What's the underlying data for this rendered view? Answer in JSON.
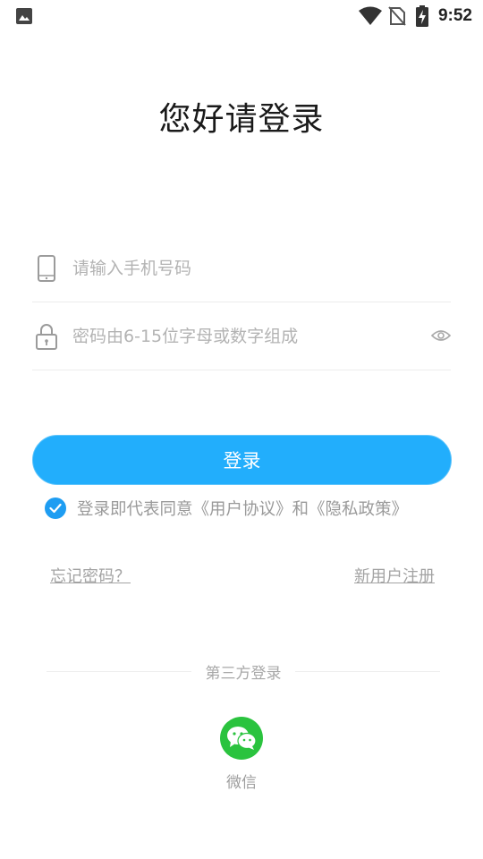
{
  "status_bar": {
    "time": "9:52",
    "icons": [
      "image-icon",
      "wifi-icon",
      "no-sim-icon",
      "battery-charging-icon"
    ]
  },
  "header": {
    "title": "您好请登录"
  },
  "form": {
    "phone": {
      "placeholder": "请输入手机号码",
      "value": "",
      "icon": "phone-icon"
    },
    "password": {
      "placeholder": "密码由6-15位字母或数字组成",
      "value": "",
      "icon": "lock-icon",
      "toggle_icon": "eye-icon"
    }
  },
  "login_button": {
    "label": "登录"
  },
  "agreement": {
    "checked": true,
    "text": "登录即代表同意《用户协议》和《隐私政策》"
  },
  "links": {
    "forgot_password": "忘记密码？",
    "register": "新用户注册"
  },
  "third_party": {
    "divider_label": "第三方登录",
    "providers": [
      {
        "label": "微信",
        "icon": "wechat-icon",
        "color": "#2ac33e"
      }
    ]
  },
  "colors": {
    "accent": "#22aefc",
    "checkbox": "#1e9df2",
    "wechat": "#2ac33e"
  }
}
